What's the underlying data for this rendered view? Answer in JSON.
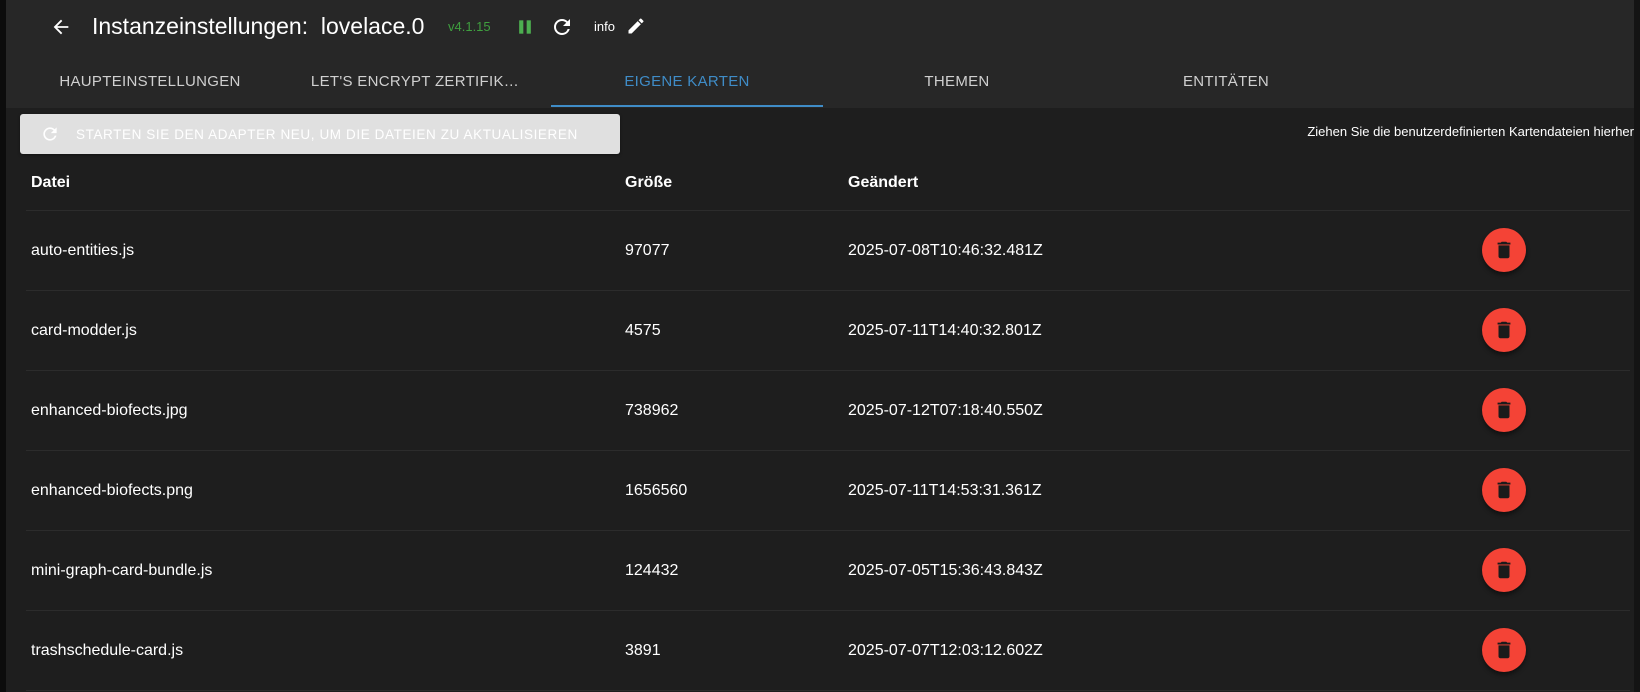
{
  "header": {
    "title": "Instanzeinstellungen:  lovelace.0",
    "version": "v4.1.15",
    "loglevel": "info",
    "icons": {
      "back": "arrow-left-icon",
      "pause": "pause-icon",
      "reload": "reload-icon",
      "edit": "pencil-icon"
    },
    "colors": {
      "version": "#3f9e3f",
      "pause": "#4caf50"
    }
  },
  "tabs": [
    {
      "label": "HAUPTEINSTELLUNGEN",
      "active": false
    },
    {
      "label": "LET'S ENCRYPT ZERTIFIK…",
      "active": false
    },
    {
      "label": "EIGENE KARTEN",
      "active": true
    },
    {
      "label": "THEMEN",
      "active": false
    },
    {
      "label": "ENTITÄTEN",
      "active": false
    }
  ],
  "toolbar": {
    "restart_label": "STARTEN SIE DEN ADAPTER NEU, UM DIE DATEIEN ZU AKTUALISIEREN",
    "restart_icon": "refresh-icon",
    "drop_hint": "Ziehen Sie die benutzerdefinierten Kartendateien hierher"
  },
  "table": {
    "columns": [
      "Datei",
      "Größe",
      "Geändert"
    ],
    "rows": [
      {
        "name": "auto-entities.js",
        "size": "97077",
        "modified": "2025-07-08T10:46:32.481Z"
      },
      {
        "name": "card-modder.js",
        "size": "4575",
        "modified": "2025-07-11T14:40:32.801Z"
      },
      {
        "name": "enhanced-biofects.jpg",
        "size": "738962",
        "modified": "2025-07-12T07:18:40.550Z"
      },
      {
        "name": "enhanced-biofects.png",
        "size": "1656560",
        "modified": "2025-07-11T14:53:31.361Z"
      },
      {
        "name": "mini-graph-card-bundle.js",
        "size": "124432",
        "modified": "2025-07-05T15:36:43.843Z"
      },
      {
        "name": "trashschedule-card.js",
        "size": "3891",
        "modified": "2025-07-07T12:03:12.602Z"
      }
    ],
    "delete_icon": "trash-icon",
    "colors": {
      "delete_button": "#f44336"
    }
  },
  "theme": {
    "accent": "#3f8cc7",
    "background": "#1e1e1e",
    "toolbar": "#272727"
  }
}
